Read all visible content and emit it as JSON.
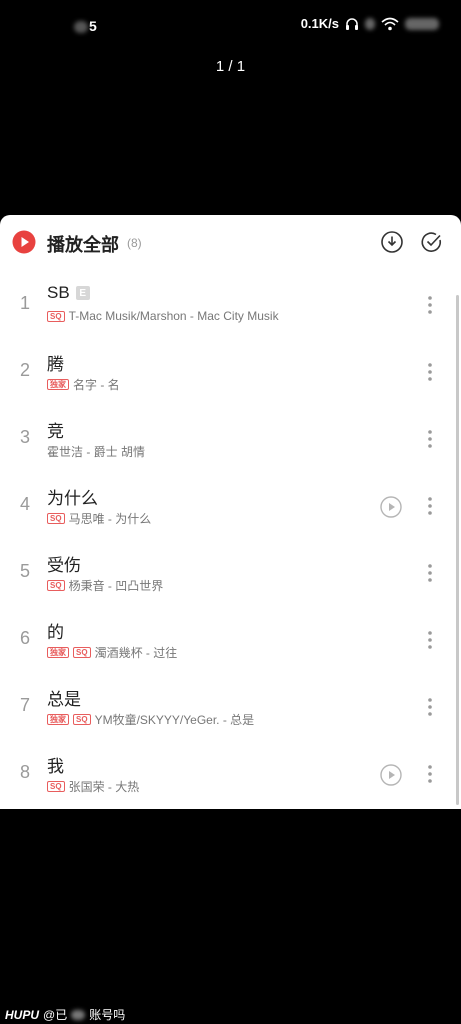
{
  "status_bar": {
    "time_partial": "5",
    "network_speed": "0.1K/s"
  },
  "viewer": {
    "page_indicator": "1 / 1"
  },
  "playlist_header": {
    "play_all_label": "播放全部",
    "count": "(8)"
  },
  "songs": [
    {
      "index": "1",
      "title": "SB",
      "explicit": true,
      "explicit_label": "E",
      "tags": [
        "SQ"
      ],
      "subtitle": "T-Mac Musik/Marshon - Mac City Musik",
      "has_mv": false
    },
    {
      "index": "2",
      "title": "腾",
      "explicit": false,
      "tags": [
        "独家"
      ],
      "subtitle": "名字 - 名",
      "has_mv": false
    },
    {
      "index": "3",
      "title": "竞",
      "explicit": false,
      "tags": [],
      "subtitle": "霍世洁 - 爵士 胡情",
      "has_mv": false
    },
    {
      "index": "4",
      "title": "为什么",
      "explicit": false,
      "tags": [
        "SQ"
      ],
      "subtitle": "马思唯 - 为什么",
      "has_mv": true
    },
    {
      "index": "5",
      "title": "受伤",
      "explicit": false,
      "tags": [
        "SQ"
      ],
      "subtitle": "杨秉音 - 凹凸世界",
      "has_mv": false
    },
    {
      "index": "6",
      "title": "的",
      "explicit": false,
      "tags": [
        "独家",
        "SQ"
      ],
      "subtitle": "濁酒幾杯 - 过往",
      "has_mv": false
    },
    {
      "index": "7",
      "title": "总是",
      "explicit": false,
      "tags": [
        "独家",
        "SQ"
      ],
      "subtitle": "YM牧童/SKYYY/YeGer. - 总是",
      "has_mv": false
    },
    {
      "index": "8",
      "title": "我",
      "explicit": false,
      "tags": [
        "SQ"
      ],
      "subtitle": "张国荣 - 大热",
      "has_mv": true
    }
  ],
  "watermark": {
    "brand": "HUPU",
    "handle_prefix": "@已",
    "handle_suffix": "账号吗"
  },
  "icons": {
    "play_all": "play-circle-icon",
    "download": "download-icon",
    "multi_select": "check-circle-icon",
    "mv": "mv-play-icon",
    "more": "more-vertical-icon"
  },
  "colors": {
    "accent_red": "#e8423f",
    "tag_red": "#e85d5d"
  }
}
